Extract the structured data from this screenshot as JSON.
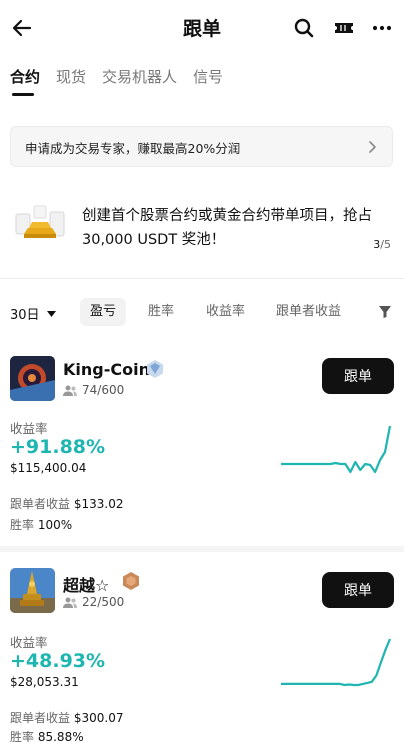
{
  "header": {
    "title": "跟单",
    "icons": [
      "back-arrow-icon",
      "search-icon",
      "ticket-icon",
      "more-icon"
    ]
  },
  "tabs": [
    {
      "label": "合约",
      "active": true
    },
    {
      "label": "现货",
      "active": false
    },
    {
      "label": "交易机器人",
      "active": false
    },
    {
      "label": "信号",
      "active": false
    }
  ],
  "banner": {
    "text": "申请成为交易专家，赚取最高20%分润"
  },
  "promo": {
    "text": "创建首个股票合约或黄金合约带单项目，抢占 30,000 USDT 奖池！",
    "page_current": "3",
    "page_total": "/5"
  },
  "filters": {
    "period": "30日",
    "options": [
      {
        "label": "盈亏",
        "active": true
      },
      {
        "label": "胜率",
        "active": false
      },
      {
        "label": "收益率",
        "active": false
      },
      {
        "label": "跟单者收益",
        "active": false
      }
    ]
  },
  "traders": [
    {
      "name": "King-Coin",
      "followers": "74/600",
      "follow_label": "跟单",
      "roi_label": "收益率",
      "roi": "+91.88%",
      "pnl": "$115,400.04",
      "follower_pnl_label": "跟单者收益",
      "follower_pnl": "$133.02",
      "win_rate_label": "胜率",
      "win_rate": "100%",
      "badge": "diamond-badge-icon",
      "spark": [
        10,
        10,
        10,
        10,
        10,
        10,
        10,
        10,
        10,
        10,
        10,
        11,
        10,
        10,
        2,
        12,
        4,
        10,
        9,
        2,
        14,
        22,
        48
      ]
    },
    {
      "name": "超越☆",
      "followers": "22/500",
      "follow_label": "跟单",
      "roi_label": "收益率",
      "roi": "+48.93%",
      "pnl": "$28,053.31",
      "follower_pnl_label": "跟单者收益",
      "follower_pnl": "$300.07",
      "win_rate_label": "胜率",
      "win_rate": "85.88%",
      "badge": "hexagon-badge-icon",
      "spark": [
        2,
        2,
        2,
        2,
        2,
        2,
        2,
        2,
        2,
        2,
        2,
        2,
        2,
        2,
        1,
        1.5,
        1,
        1,
        2,
        3,
        4,
        10,
        22,
        34,
        44
      ]
    }
  ],
  "colors": {
    "accent": "#1fb5b0",
    "button": "#111111"
  }
}
